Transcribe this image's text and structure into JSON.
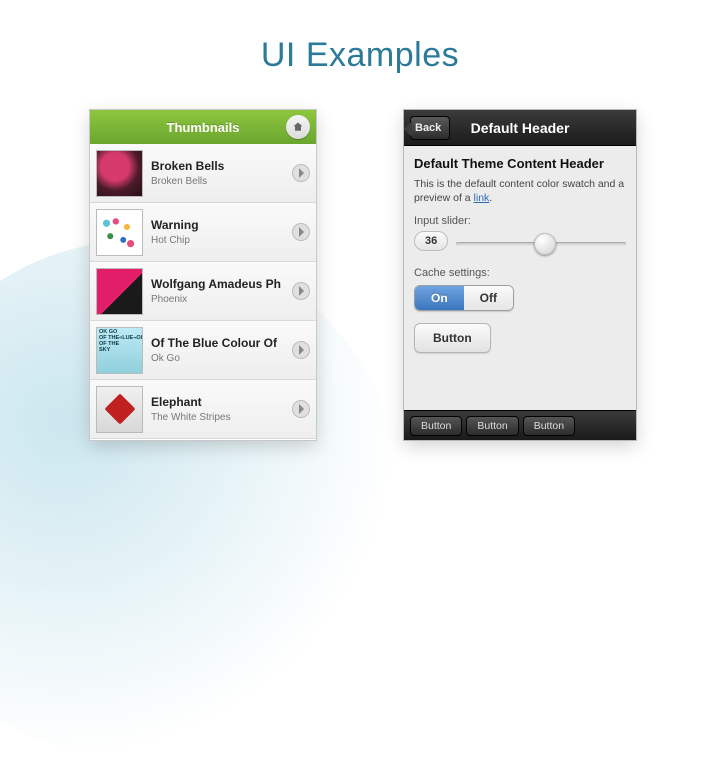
{
  "slide": {
    "title": "UI Examples"
  },
  "left": {
    "headerTitle": "Thumbnails",
    "items": [
      {
        "title": "Broken Bells",
        "subtitle": "Broken Bells"
      },
      {
        "title": "Warning",
        "subtitle": "Hot Chip"
      },
      {
        "title": "Wolfgang Amadeus Ph",
        "subtitle": "Phoenix"
      },
      {
        "title": "Of The Blue Colour Of",
        "subtitle": "Ok Go"
      },
      {
        "title": "Elephant",
        "subtitle": "The White Stripes"
      }
    ]
  },
  "right": {
    "backLabel": "Back",
    "headerTitle": "Default Header",
    "contentHeader": "Default Theme Content Header",
    "descPrefix": "This is the default content color swatch and a preview of a ",
    "descLinkText": "link",
    "descSuffix": ".",
    "sliderLabel": "Input slider:",
    "sliderValue": "36",
    "cacheLabel": "Cache settings:",
    "segOn": "On",
    "segOff": "Off",
    "buttonLabel": "Button",
    "footerButtons": [
      "Button",
      "Button",
      "Button"
    ]
  }
}
